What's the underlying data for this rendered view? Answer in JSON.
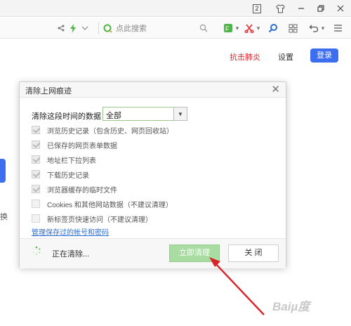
{
  "titlebar": {
    "badge": "2",
    "icons": [
      "shirt-icon",
      "minimize-icon",
      "restore-icon",
      "close-icon"
    ]
  },
  "toolbar": {
    "search_placeholder": "点此搜索"
  },
  "page": {
    "red_link": "抗击肺炎",
    "settings": "设置",
    "login": "登录",
    "left_char": "换"
  },
  "dialog": {
    "title": "清除上网痕迹",
    "range_label": "清除这段时间的数据：",
    "range_value": "全部",
    "options": [
      {
        "label": "浏览历史记录（包含历史、网页回收站）",
        "checked": true
      },
      {
        "label": "已保存的网页表单数据",
        "checked": true
      },
      {
        "label": "地址栏下拉列表",
        "checked": true
      },
      {
        "label": "下载历史记录",
        "checked": true
      },
      {
        "label": "浏览器缓存的临时文件",
        "checked": true
      },
      {
        "label": "Cookies 和其他网站数据（不建议清理）",
        "checked": false
      },
      {
        "label": "新标签页快速访问（不建议清理）",
        "checked": false
      }
    ],
    "manage_link": "管理保存过的帐号和密码",
    "status": "正在清除...",
    "clean_button": "立即清理",
    "close_button": "关 闭"
  },
  "watermark": "Baiµ度",
  "colors": {
    "accent_blue": "#3d6ef0",
    "red_link": "#d6262f",
    "clean_button": "#a8dca0",
    "arrow": "#d9232b"
  }
}
